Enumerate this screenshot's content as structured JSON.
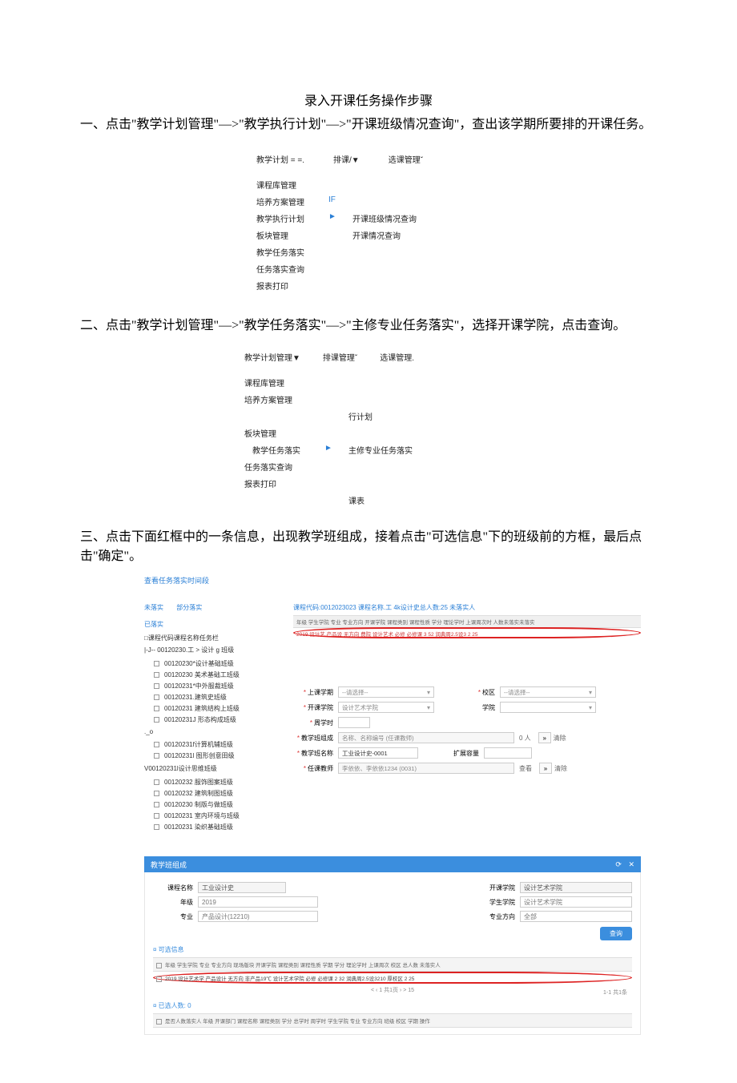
{
  "doc": {
    "title": "录入开课任务操作步骤",
    "p1": "一、点击\"教学计划管理\"—>\"教学执行计划\"—>\"开课班级情况查询\"，查出该学期所要排的开课任务。",
    "p2": "二、点击\"教学计划管理\"—>\"教学任务落实\"—>\"主修专业任务落实\"，选择开课学院，点击查询。",
    "p3": "三、点击下面红框中的一条信息，出现教学班组成，接着点击\"可选信息\"下的班级前的方框，最后点击\"确定\"。"
  },
  "shot1": {
    "topbar": [
      "教学计划 = =.",
      "排课/▼",
      "选课管理ˇ"
    ],
    "rows": [
      {
        "c1": "课程库管理",
        "c2": "",
        "c3": ""
      },
      {
        "c1": "培养方案管理",
        "c2": "IF",
        "c3": ""
      },
      {
        "c1": "教学执行计划",
        "c2": "►",
        "c3": "开课班级情况查询"
      },
      {
        "c1": "板块管理",
        "c2": "",
        "c3": "开课情况查询"
      },
      {
        "c1": "教学任务落实",
        "c2": "",
        "c3": ""
      },
      {
        "c1": "任务落实查询",
        "c2": "",
        "c3": ""
      },
      {
        "c1": "报表打印",
        "c2": "",
        "c3": ""
      }
    ]
  },
  "shot2": {
    "topbar": [
      "教学计划管理▼",
      "排课管理ˇ",
      "选课管理."
    ],
    "rows": [
      {
        "c1": "课程库管理",
        "c2": "",
        "c3": ""
      },
      {
        "c1": "培养方案管理",
        "c2": "",
        "c3": ""
      },
      {
        "c1": "",
        "c2": "",
        "c3": "行计划"
      },
      {
        "c1": "板块管理",
        "c2": "",
        "c3": ""
      },
      {
        "c1": "　教学任务落实",
        "c2": "►",
        "c3": "主修专业任务落实"
      },
      {
        "c1": "任务落实查询",
        "c2": "",
        "c3": ""
      },
      {
        "c1": "报表打印",
        "c2": "",
        "c3": ""
      },
      {
        "c1": "",
        "c2": "",
        "c3": "课表"
      }
    ]
  },
  "shot3": {
    "link_top": "查看任务落实时间段",
    "tabs": [
      "未落实",
      "部分落实"
    ],
    "tabs2": "已落实",
    "tree_head1": "□课程代码课程名称任务栏",
    "tree_group1": "|-J-- 00120230.工 > 设计 g 班级",
    "tree_items1": [
      "00120230*设计基础班级",
      "00120230 美术基础工班级",
      "00120231*中外服裁班级",
      "00120231.建筑史班级",
      "00120231 建筑结构上班级",
      "00120231J 形态构成班级"
    ],
    "tree_group2": "._o",
    "tree_items2": [
      "00120231f计算机辅班级",
      "00120231l 图形创意田级"
    ],
    "tree_group3": "V00120231l设计思维班级",
    "tree_items3": [
      "00120232 服饰图案班级",
      "00120232 建筑制图班级",
      "00120230 制版与做班级",
      "00120231 室内环境与班级",
      "00120231 染织基础班级"
    ],
    "summary": "课程代码:0012023023 课程名称.工 4k设计史总人数:25 未落实人",
    "hdr": "年级 学生学院 专业 专业方向 开课学院 课程类别 课程性质 学分 理论学时 上课周次时 人数未落实未落实",
    "row": "2019 设计艺 产品设 无方向 费院 设计艺术 必修 必修课 3 52 润典周2.5设3 2 25",
    "form": {
      "lab_term": "上课学期",
      "val_term": "--请选择--",
      "lab_campus": "校区",
      "val_campus": "--请选择--",
      "lab_col": "开课学院",
      "val_col": "设计艺术学院",
      "lab_dept": "学院",
      "lab_hours": "周学时",
      "lab_comp": "教学班组成",
      "val_comp": "名称、名称编号 (任课教师)",
      "comp_people": "0 人",
      "btn_clear": "清除",
      "lab_name": "教学班名称",
      "val_name": "工业设计史-0001",
      "lab_cap": "扩展容量",
      "lab_teacher": "任课教师",
      "val_teacher": "李依依、李依依1234 (0031)",
      "btn_find": "查看"
    }
  },
  "shot4": {
    "title": "教学班组成",
    "icons": {
      "refresh": "⟳",
      "close": "✕"
    },
    "lab_course": "课程名称",
    "val_course": "工业设计史",
    "lab_col": "开课学院",
    "val_col": "设计艺术学院",
    "lab_year": "年级",
    "val_year": "2019",
    "lab_scol": "学生学院",
    "val_scol": "设计艺术学院",
    "lab_major": "专业",
    "val_major": "产品设计(12210)",
    "lab_dir": "专业方向",
    "val_dir": "全部",
    "btn_query": "查询",
    "sec_opt": "可选信息",
    "hdr_opt": "年级 学生学院 专业 专业方向 现场版块 开课学院 课程类别 课程性质 学期 学分 理论学时 上课周次 校区 总人数 未落实人",
    "row_opt": "2019 设计艺术学 产品设计 无方向 非产品19℃ 设计艺术学院 必修 必修课 2 32 润典周2.5设3210 厚校区 2 25",
    "pager": "< ‹ 1 共1页 › > 15",
    "pager_right": "1-1  共1条",
    "sec_sel": "已选人数: 0",
    "hdr_sel": "是否人数落实人 年级 开课部门 课程名称 课程类别 学分 总学时 周学时 学生学院 专业 专业方向 班级 校区 学期 操作"
  }
}
